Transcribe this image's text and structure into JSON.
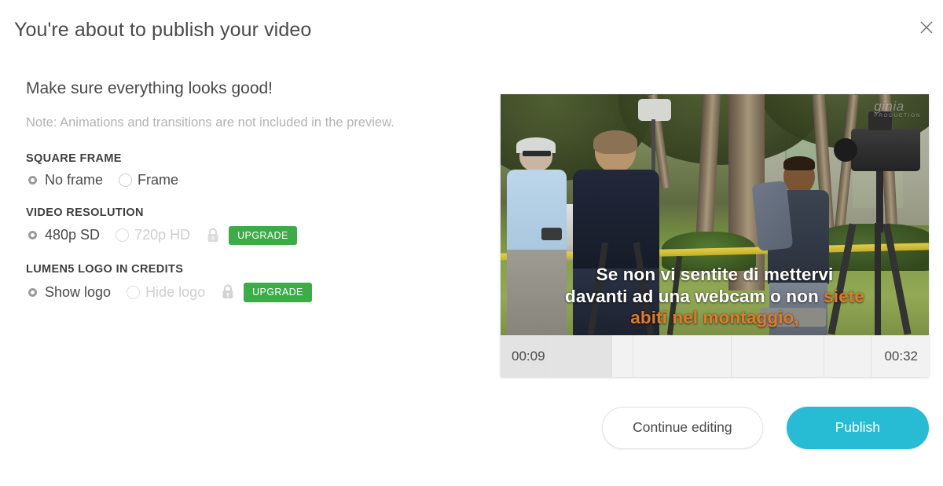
{
  "dialog": {
    "title": "You're about to publish your video",
    "close_icon": "close-icon",
    "subtitle": "Make sure everything looks good!",
    "note": "Note: Animations and transitions are not included in the preview."
  },
  "options": {
    "square_frame": {
      "label": "SQUARE FRAME",
      "choices": [
        {
          "label": "No frame",
          "selected": true,
          "locked": false
        },
        {
          "label": "Frame",
          "selected": false,
          "locked": false
        }
      ]
    },
    "video_resolution": {
      "label": "VIDEO RESOLUTION",
      "choices": [
        {
          "label": "480p SD",
          "selected": true,
          "locked": false
        },
        {
          "label": "720p HD",
          "selected": false,
          "locked": true
        }
      ],
      "lock_icon": "lock-icon",
      "upgrade_label": "UPGRADE"
    },
    "logo_in_credits": {
      "label": "LUMEN5 LOGO IN CREDITS",
      "choices": [
        {
          "label": "Show logo",
          "selected": true,
          "locked": false
        },
        {
          "label": "Hide logo",
          "selected": false,
          "locked": true
        }
      ],
      "lock_icon": "lock-icon",
      "upgrade_label": "UPGRADE"
    }
  },
  "preview": {
    "watermark": "ginia",
    "watermark_sub": "PRODUCTION",
    "caption_line1": "Se non vi sentite di mettervi",
    "caption_line2_white": "davanti ad una webcam o non ",
    "caption_line2_highlight": "siete",
    "caption_line3_highlight": "abiti nel montaggio,",
    "timeline": {
      "current_time": "00:09",
      "total_time": "00:32"
    }
  },
  "footer": {
    "continue_label": "Continue editing",
    "publish_label": "Publish"
  },
  "colors": {
    "publish": "#27bcd4",
    "upgrade": "#3cab48",
    "caption_highlight": "#e07a2a"
  }
}
